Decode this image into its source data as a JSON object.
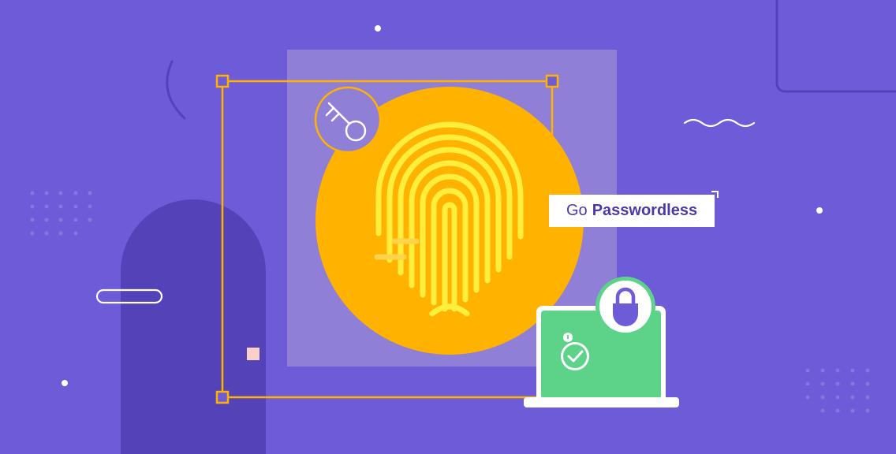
{
  "banner": {
    "cta_prefix": "Go",
    "cta_emphasis": "Passwordless"
  },
  "colors": {
    "background": "#6e5bd8",
    "accent_orange": "#ffb300",
    "fingerprint_yellow": "#ffee3c",
    "laptop_green": "#5dd38a",
    "arch_purple": "#5443b8",
    "panel_lavender": "#8f7fd6"
  },
  "icons": [
    "key-icon",
    "fingerprint-icon",
    "padlock-icon",
    "checkmark-icon",
    "laptop-icon"
  ]
}
